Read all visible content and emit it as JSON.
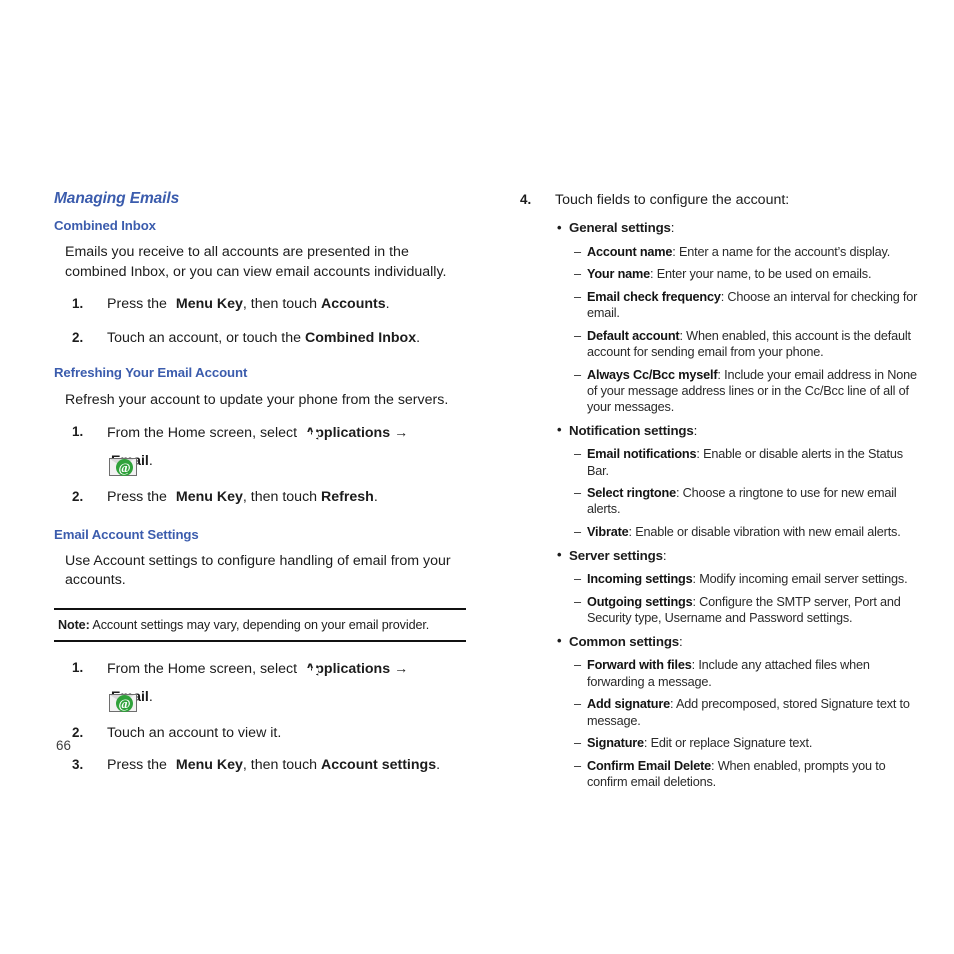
{
  "page": {
    "folio": "66"
  },
  "left_column": {
    "chapter_heading": "Managing Emails",
    "sections": [
      {
        "heading": "Combined Inbox",
        "paragraph": "Emails you receive to all accounts are presented in the combined Inbox, or you can view email accounts individually.",
        "steps": [
          {
            "num": "1.",
            "pre": "Press the",
            "icon": "menu-key-icon",
            "bold1": "Menu Key",
            "mid": ", then touch ",
            "bold2": "Accounts",
            "post": "."
          },
          {
            "num": "2.",
            "pre": "Touch an account, or touch the ",
            "bold2": "Combined Inbox",
            "post": "."
          }
        ]
      },
      {
        "heading": "Refreshing Your Email Account",
        "paragraph": "Refresh your account to update your phone from the servers.",
        "steps": [
          {
            "num": "1.",
            "pre": "From the Home screen, select",
            "icon_apps": "applications-icon",
            "bold_apps": "Applications",
            "arrow": "→",
            "icon_email": "email-icon",
            "bold_email": "Email",
            "post": "."
          },
          {
            "num": "2.",
            "pre": "Press the",
            "icon": "menu-key-icon",
            "bold1": "Menu Key",
            "mid": ", then touch ",
            "bold2": "Refresh",
            "post": "."
          }
        ]
      },
      {
        "heading": "Email Account Settings",
        "paragraph": "Use Account settings to configure handling of email from your accounts.",
        "note": {
          "label": "Note:",
          "text": " Account settings may vary, depending on your email provider."
        },
        "steps": [
          {
            "num": "1.",
            "pre": "From the Home screen, select",
            "icon_apps": "applications-icon",
            "bold_apps": "Applications",
            "arrow": "→",
            "icon_email": "email-icon",
            "bold_email": "Email",
            "post": "."
          },
          {
            "num": "2.",
            "pre": "Touch an account to view it."
          },
          {
            "num": "3.",
            "pre": "Press the",
            "icon": "menu-key-icon",
            "bold1": "Menu Key",
            "mid": ", then touch ",
            "bold2": "Account settings",
            "post": "."
          }
        ]
      }
    ]
  },
  "right_column": {
    "step": {
      "num": "4.",
      "text": "Touch fields to configure the account:"
    },
    "groups": [
      {
        "label": "General settings",
        "colon": ":",
        "items": [
          {
            "term": "Account name",
            "desc": ": Enter a name for the account’s display."
          },
          {
            "term": "Your name",
            "desc": ": Enter your name, to be used on emails."
          },
          {
            "term": "Email check frequency",
            "desc": ": Choose an interval for checking for email."
          },
          {
            "term": "Default account",
            "desc": ": When enabled, this account is the default account for sending email from your phone."
          },
          {
            "term": "Always Cc/Bcc myself",
            "desc": ": Include your email address in None of your message address lines or in the Cc/Bcc line of all of your messages."
          }
        ]
      },
      {
        "label": "Notification settings",
        "colon": ":",
        "items": [
          {
            "term": "Email notifications",
            "desc": ": Enable or disable alerts in the Status Bar."
          },
          {
            "term": "Select ringtone",
            "desc": ": Choose a ringtone to use for new email alerts."
          },
          {
            "term": "Vibrate",
            "desc": ": Enable or disable vibration with new email alerts."
          }
        ]
      },
      {
        "label": "Server settings",
        "colon": ":",
        "items": [
          {
            "term": "Incoming settings",
            "desc": ": Modify incoming email server settings."
          },
          {
            "term": "Outgoing settings",
            "desc": ": Configure the SMTP server, Port and Security type, Username and Password settings."
          }
        ]
      },
      {
        "label": "Common settings",
        "colon": ":",
        "items": [
          {
            "term": "Forward with files",
            "desc": ": Include any attached files when forwarding a message."
          },
          {
            "term": "Add signature",
            "desc": ": Add precomposed, stored Signature text to message."
          },
          {
            "term": "Signature",
            "desc": ": Edit or replace Signature text."
          },
          {
            "term": "Confirm Email Delete",
            "desc": ": When enabled, prompts you to confirm email deletions."
          }
        ]
      }
    ]
  }
}
